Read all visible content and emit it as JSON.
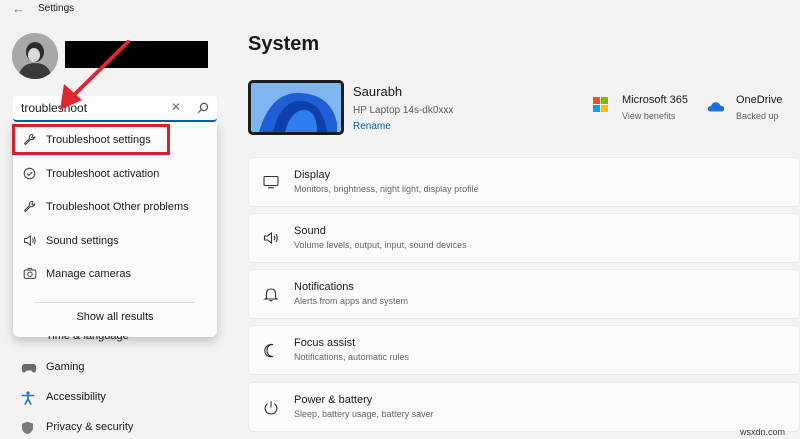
{
  "app": {
    "title": "Settings"
  },
  "search": {
    "query": "troubleshoot",
    "results": [
      {
        "label": "Troubleshoot settings",
        "icon": "wrench-icon"
      },
      {
        "label": "Troubleshoot activation",
        "icon": "check-circle-icon"
      },
      {
        "label": "Troubleshoot Other problems",
        "icon": "wrench-icon"
      },
      {
        "label": "Sound settings",
        "icon": "speaker-icon"
      },
      {
        "label": "Manage cameras",
        "icon": "camera-icon"
      }
    ],
    "show_all": "Show all results"
  },
  "sidebar": {
    "partial_label": "Time & language",
    "items": [
      {
        "label": "Gaming",
        "icon": "gaming-icon"
      },
      {
        "label": "Accessibility",
        "icon": "accessibility-icon"
      },
      {
        "label": "Privacy & security",
        "icon": "shield-icon"
      }
    ]
  },
  "main": {
    "title": "System",
    "device": {
      "name": "Saurabh",
      "model": "HP Laptop 14s-dk0xxx",
      "rename": "Rename"
    },
    "tiles": [
      {
        "title": "Microsoft 365",
        "subtitle": "View benefits",
        "icon": "microsoft-logo-icon"
      },
      {
        "title": "OneDrive",
        "subtitle": "Backed up",
        "icon": "onedrive-icon"
      }
    ],
    "cards": [
      {
        "title": "Display",
        "subtitle": "Monitors, brightness, night light, display profile",
        "icon": "display-icon"
      },
      {
        "title": "Sound",
        "subtitle": "Volume levels, output, input, sound devices",
        "icon": "speaker-icon"
      },
      {
        "title": "Notifications",
        "subtitle": "Alerts from apps and system",
        "icon": "bell-icon"
      },
      {
        "title": "Focus assist",
        "subtitle": "Notifications, automatic rules",
        "icon": "moon-icon"
      },
      {
        "title": "Power & battery",
        "subtitle": "Sleep, battery usage, battery saver",
        "icon": "power-icon"
      }
    ]
  },
  "watermark": "wsxdn.com",
  "colors": {
    "accent": "#005fb8",
    "highlight": "#d3202f",
    "background": "#f3f3f3",
    "card": "#fbfbfb"
  }
}
